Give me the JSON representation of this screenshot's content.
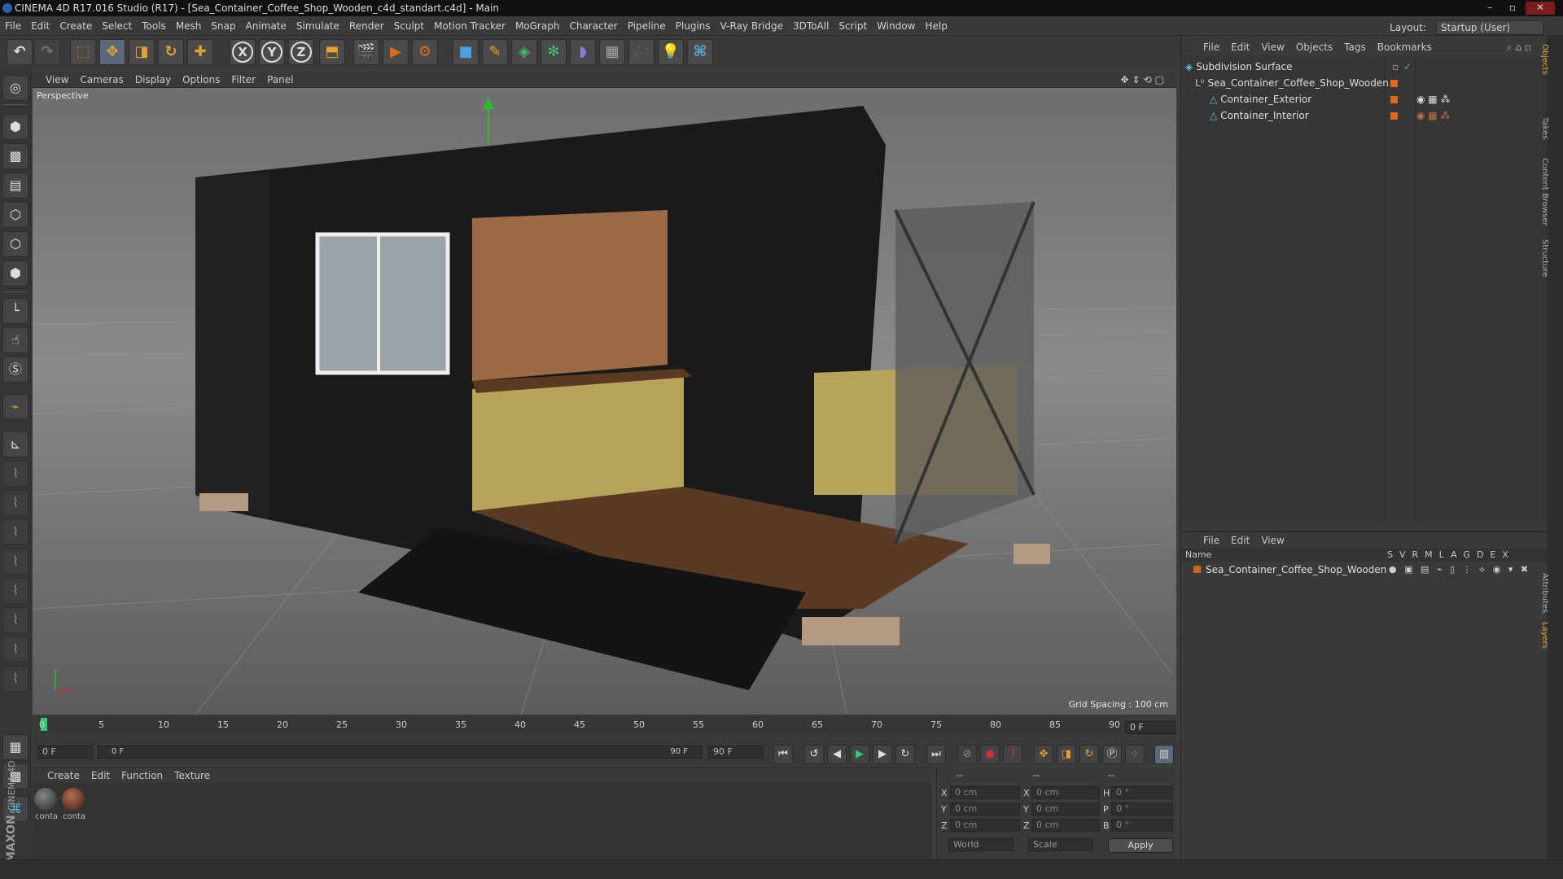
{
  "window": {
    "title": "CINEMA 4D R17.016 Studio (R17) - [Sea_Container_Coffee_Shop_Wooden_c4d_standart.c4d] - Main",
    "layout_label": "Layout:",
    "layout_value": "Startup (User)"
  },
  "menu": [
    "File",
    "Edit",
    "Create",
    "Select",
    "Tools",
    "Mesh",
    "Snap",
    "Animate",
    "Simulate",
    "Render",
    "Sculpt",
    "Motion Tracker",
    "MoGraph",
    "Character",
    "Pipeline",
    "Plugins",
    "V-Ray Bridge",
    "3DToAll",
    "Script",
    "Window",
    "Help"
  ],
  "toolbar_icons": [
    "undo-icon",
    "redo-icon",
    "live-select-icon",
    "move-icon",
    "scale-icon",
    "rotate-icon",
    "last-tool-icon",
    "x-axis-icon",
    "y-axis-icon",
    "z-axis-icon",
    "coord-system-icon",
    "render-view-icon",
    "render-picture-viewer-icon",
    "render-settings-icon",
    "cube-icon",
    "pen-spline-icon",
    "subdivision-icon",
    "array-icon",
    "deformer-icon",
    "floor-icon",
    "camera-icon",
    "light-icon",
    "python-icon"
  ],
  "toolbar_glyphs": {
    "x": "X",
    "y": "Y",
    "z": "Z"
  },
  "viewport": {
    "menu": [
      "View",
      "Cameras",
      "Display",
      "Options",
      "Filter",
      "Panel"
    ],
    "label": "Perspective",
    "grid_spacing": "Grid Spacing : 100 cm"
  },
  "timeline": {
    "ticks": [
      "0",
      "5",
      "10",
      "15",
      "20",
      "25",
      "30",
      "35",
      "40",
      "45",
      "50",
      "55",
      "60",
      "65",
      "70",
      "75",
      "80",
      "85",
      "90"
    ],
    "current_frame": "0 F",
    "start_field": "0 F",
    "range_start": "0 F",
    "range_end": "90 F",
    "end_field": "90 F"
  },
  "materials": {
    "menu": [
      "Create",
      "Edit",
      "Function",
      "Texture"
    ],
    "items": [
      {
        "label": "conta",
        "color": "#3a3a3a"
      },
      {
        "label": "conta",
        "color": "#6a3a22"
      }
    ]
  },
  "coords": {
    "headers": [
      "--",
      "--",
      "--"
    ],
    "rows": [
      {
        "a": "X",
        "av": "0 cm",
        "b": "X",
        "bv": "0 cm",
        "c": "H",
        "cv": "0 °"
      },
      {
        "a": "Y",
        "av": "0 cm",
        "b": "Y",
        "bv": "0 cm",
        "c": "P",
        "cv": "0 °"
      },
      {
        "a": "Z",
        "av": "0 cm",
        "b": "Z",
        "bv": "0 cm",
        "c": "B",
        "cv": "0 °"
      }
    ],
    "mode": "World",
    "scale": "Scale",
    "apply": "Apply"
  },
  "objects": {
    "menu": [
      "File",
      "Edit",
      "View",
      "Objects",
      "Tags",
      "Bookmarks"
    ],
    "items": [
      {
        "name": "Subdivision Surface",
        "indent": 0
      },
      {
        "name": "Sea_Container_Coffee_Shop_Wooden",
        "indent": 1
      },
      {
        "name": "Container_Exterior",
        "indent": 2
      },
      {
        "name": "Container_Interior",
        "indent": 2
      }
    ]
  },
  "layers": {
    "menu": [
      "File",
      "Edit",
      "View"
    ],
    "name_header": "Name",
    "flags": [
      "S",
      "V",
      "R",
      "M",
      "L",
      "A",
      "G",
      "D",
      "E",
      "X"
    ],
    "items": [
      {
        "name": "Sea_Container_Coffee_Shop_Wooden",
        "color": "#d0641e"
      }
    ]
  },
  "side_tabs": [
    "Objects",
    "Takes",
    "Content Browser",
    "Structure",
    "Attributes",
    "Layers"
  ],
  "brand": {
    "maxon": "MAXON",
    "product": "CINEMA 4D"
  },
  "colors": {
    "accent": "#e06a1a",
    "axis_x": "#c0392b",
    "axis_y": "#27ae60",
    "axis_z": "#2e6fbf"
  }
}
